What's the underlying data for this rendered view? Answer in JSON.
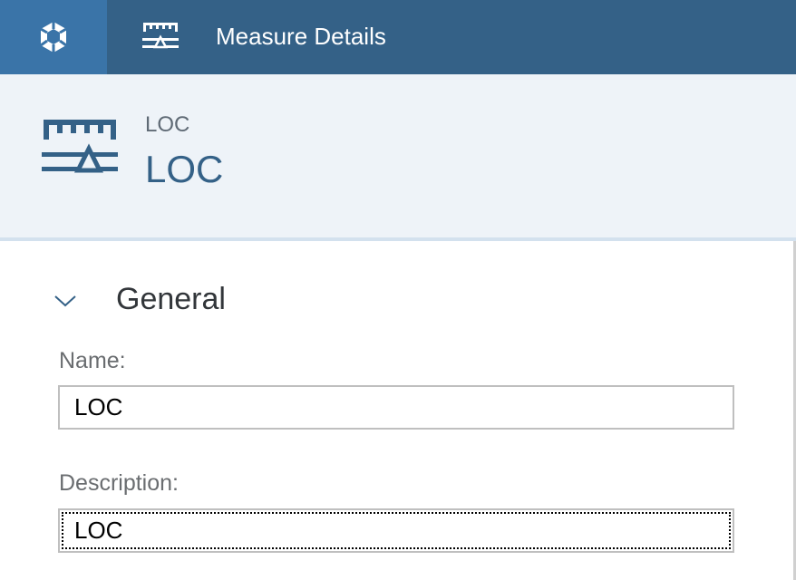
{
  "topbar": {
    "home_icon": "cube-icon",
    "app_icon": "measure-icon",
    "title": "Measure Details"
  },
  "header": {
    "icon": "measure-icon",
    "subtitle": "LOC",
    "title": "LOC"
  },
  "section": {
    "toggle_icon": "chevron-down-icon",
    "title": "General",
    "expanded": true
  },
  "form": {
    "name_label": "Name:",
    "name_value": "LOC",
    "description_label": "Description:",
    "description_value": "LOC",
    "focused_field": "description"
  },
  "colors": {
    "shell": "#346187",
    "home": "#3a74a8",
    "header_bg": "#eef3f8",
    "accent": "#346187"
  }
}
